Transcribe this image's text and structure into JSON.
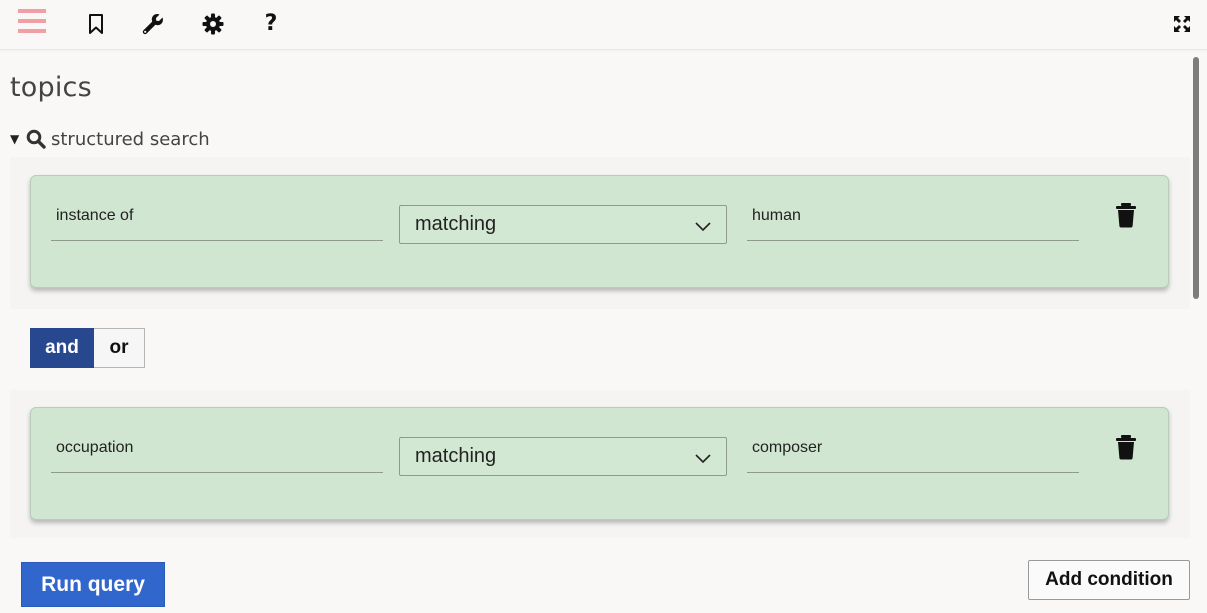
{
  "toolbar": {
    "icons": [
      "menu-icon",
      "bookmark-icon",
      "wrench-icon",
      "gear-icon",
      "help-icon",
      "expand-icon"
    ],
    "help_glyph": "?",
    "menu_color": "#f0a0a4"
  },
  "page": {
    "title": "topics"
  },
  "search": {
    "caret": "▼",
    "label": "structured search"
  },
  "conditions": [
    {
      "property": "instance of",
      "operator": "matching",
      "value": "human"
    },
    {
      "property": "occupation",
      "operator": "matching",
      "value": "composer"
    }
  ],
  "logic": {
    "and_label": "and",
    "or_label": "or",
    "selected": "and"
  },
  "actions": {
    "run_label": "Run query",
    "add_label": "Add condition"
  },
  "colors": {
    "card_bg": "#d0e6d0",
    "and_active": "#27478f",
    "run_button": "#3166cc"
  }
}
